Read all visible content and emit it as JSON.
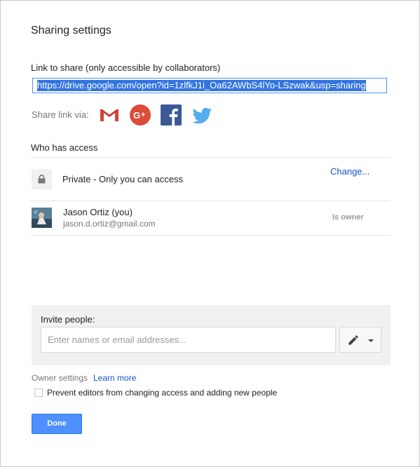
{
  "dialog": {
    "title": "Sharing settings",
    "link_label": "Link to share (only accessible by collaborators)",
    "link_value": "https://drive.google.com/open?id=1zlfkJ1i_Oa62AWbS4lYo-LSzwak&usp=sharing",
    "share_via_label": "Share link via:",
    "social_icons": [
      "gmail-icon",
      "google-plus-icon",
      "facebook-icon",
      "twitter-icon"
    ],
    "who_has_access": "Who has access",
    "access": {
      "private_text": "Private - Only you can access",
      "change_label": "Change..."
    },
    "owner": {
      "name": "Jason Ortiz (you)",
      "email": "jason.d.ortiz@gmail.com",
      "role": "Is owner"
    },
    "invite": {
      "label": "Invite people:",
      "placeholder": "Enter names or email addresses..."
    },
    "owner_settings": {
      "label": "Owner settings",
      "learn_more": "Learn more",
      "prevent_label": "Prevent editors from changing access and adding new people",
      "prevent_checked": false
    },
    "done_label": "Done"
  },
  "colors": {
    "accent": "#4d90fe",
    "link": "#1155cc",
    "gmail_red": "#d44638",
    "gplus_red": "#dd4b39",
    "facebook_blue": "#3b5998",
    "twitter_blue": "#55acee"
  }
}
